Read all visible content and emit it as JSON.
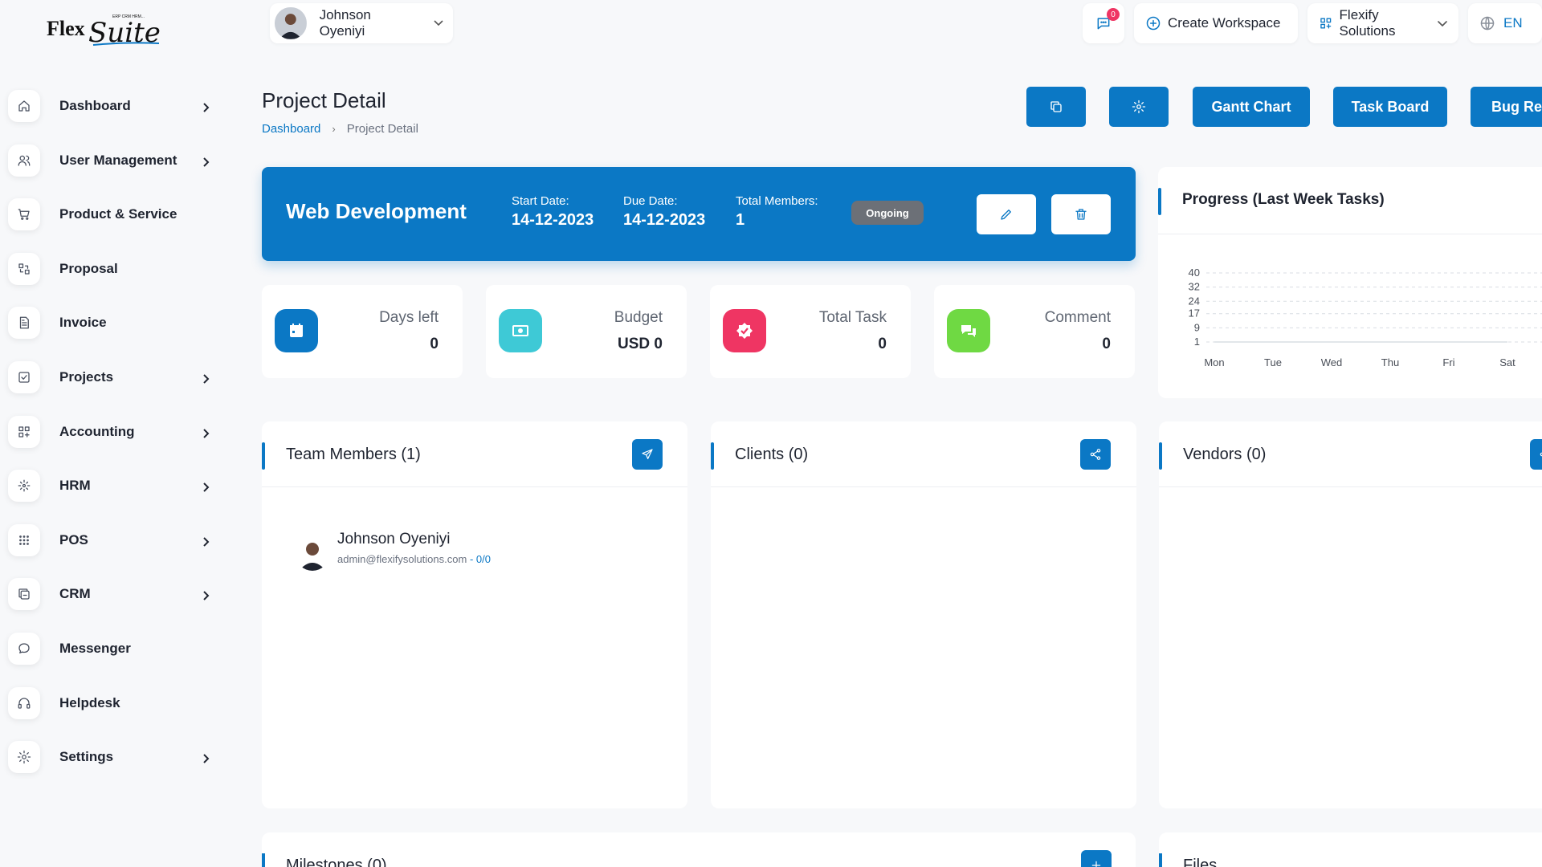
{
  "app": {
    "logo_text": "FlexSuite",
    "logo_tagline": "ERP CRM HRM..."
  },
  "colors": {
    "primary": "#0b78c5",
    "status_badge": "#6c7077",
    "days_left_icon": "#0b78c5",
    "budget_icon": "#3ec9d6",
    "task_icon": "#ef3563",
    "comment_icon": "#6fd943"
  },
  "sidebar": {
    "items": [
      {
        "label": "Dashboard",
        "icon": "home-icon",
        "has_submenu": true
      },
      {
        "label": "User Management",
        "icon": "users-icon",
        "has_submenu": true
      },
      {
        "label": "Product & Service",
        "icon": "cart-icon",
        "has_submenu": false
      },
      {
        "label": "Proposal",
        "icon": "proposal-icon",
        "has_submenu": false
      },
      {
        "label": "Invoice",
        "icon": "invoice-icon",
        "has_submenu": false
      },
      {
        "label": "Projects",
        "icon": "checkbox-icon",
        "has_submenu": true
      },
      {
        "label": "Accounting",
        "icon": "grid-icon",
        "has_submenu": true
      },
      {
        "label": "HRM",
        "icon": "hrm-icon",
        "has_submenu": true
      },
      {
        "label": "POS",
        "icon": "dots-grid-icon",
        "has_submenu": true
      },
      {
        "label": "CRM",
        "icon": "crm-icon",
        "has_submenu": true
      },
      {
        "label": "Messenger",
        "icon": "chat-icon",
        "has_submenu": false
      },
      {
        "label": "Helpdesk",
        "icon": "headset-icon",
        "has_submenu": false
      },
      {
        "label": "Settings",
        "icon": "gear-icon",
        "has_submenu": true
      }
    ]
  },
  "topbar": {
    "user_name": "Johnson Oyeniyi",
    "notification_count": "0",
    "create_workspace": "Create Workspace",
    "workspace_name": "Flexify Solutions",
    "language": "EN"
  },
  "page": {
    "title": "Project Detail",
    "breadcrumb": [
      "Dashboard",
      "Project Detail"
    ],
    "actions": {
      "gantt": "Gantt Chart",
      "task_board": "Task Board",
      "bug_report": "Bug Report"
    }
  },
  "project": {
    "name": "Web Development",
    "start_label": "Start Date:",
    "start_date": "14-12-2023",
    "due_label": "Due Date:",
    "due_date": "14-12-2023",
    "members_label": "Total Members:",
    "members_count": "1",
    "status": "Ongoing"
  },
  "stats": [
    {
      "label": "Days left",
      "value": "0",
      "icon": "calendar-icon"
    },
    {
      "label": "Budget",
      "value": "USD 0",
      "icon": "money-icon"
    },
    {
      "label": "Total Task",
      "value": "0",
      "icon": "check-icon"
    },
    {
      "label": "Comment",
      "value": "0",
      "icon": "comments-icon"
    }
  ],
  "progress_card": {
    "title": "Progress (Last Week Tasks)"
  },
  "chart_data": {
    "type": "line",
    "title": "Progress (Last Week Tasks)",
    "categories": [
      "Mon",
      "Tue",
      "Wed",
      "Thu",
      "Fri",
      "Sat"
    ],
    "y_ticks": [
      "40",
      "32",
      "24",
      "17",
      "9",
      "1"
    ],
    "ylim": [
      1,
      40
    ],
    "grid": true,
    "series": [
      {
        "values": [
          0,
          0,
          0,
          0,
          0,
          0
        ]
      }
    ]
  },
  "team": {
    "title": "Team Members (1)",
    "members": [
      {
        "name": "Johnson Oyeniyi",
        "email": "admin@flexifysolutions.com",
        "separator": " - ",
        "ratio": "0/0"
      }
    ]
  },
  "clients": {
    "title": "Clients (0)"
  },
  "vendors": {
    "title": "Vendors (0)"
  },
  "milestones": {
    "title": "Milestones (0)"
  },
  "files": {
    "title": "Files"
  }
}
